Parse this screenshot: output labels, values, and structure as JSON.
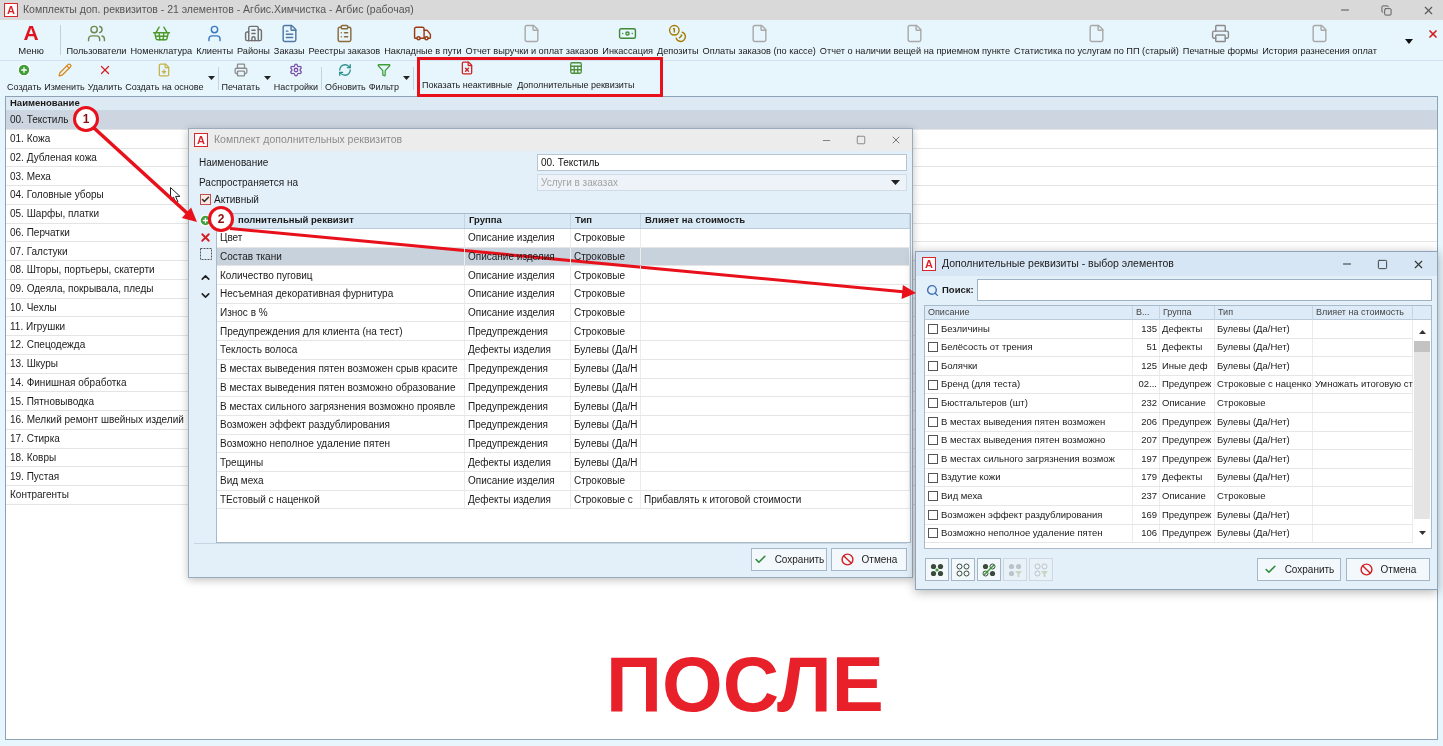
{
  "window": {
    "logo": "A",
    "title": "Комплекты доп. реквизитов - 21 элементов - Агбис.Химчистка - Агбис (рабочая)"
  },
  "ribbon": {
    "menu": {
      "logo": "A",
      "label": "Меню"
    },
    "items": [
      {
        "label": "Пользователи"
      },
      {
        "label": "Номенклатура"
      },
      {
        "label": "Клиенты"
      },
      {
        "label": "Районы"
      },
      {
        "label": "Заказы"
      },
      {
        "label": "Реестры заказов"
      },
      {
        "label": "Накладные в пути"
      },
      {
        "label": "Отчет выручки и оплат заказов"
      },
      {
        "label": "Инкассация"
      },
      {
        "label": "Депозиты"
      },
      {
        "label": "Оплаты заказов (по кассе)"
      },
      {
        "label": "Отчет о наличии вещей на приемном пункте"
      },
      {
        "label": "Статистика по услугам по ПП (старый)"
      },
      {
        "label": "Печатные формы"
      },
      {
        "label": "История разнесения оплат"
      }
    ]
  },
  "toolbar": {
    "groups": [
      {
        "highlighted": false,
        "items": [
          {
            "label": "Создать",
            "dropdown": false
          },
          {
            "label": "Изменить",
            "dropdown": false
          },
          {
            "label": "Удалить",
            "dropdown": false
          },
          {
            "label": "Создать на основе",
            "dropdown": true
          }
        ]
      },
      {
        "highlighted": false,
        "items": [
          {
            "label": "Печатать",
            "dropdown": true
          },
          {
            "label": "Настройки",
            "dropdown": false
          }
        ]
      },
      {
        "highlighted": false,
        "items": [
          {
            "label": "Обновить",
            "dropdown": false
          },
          {
            "label": "Фильтр",
            "dropdown": true
          }
        ]
      },
      {
        "highlighted": true,
        "items": [
          {
            "label": "Показать неактивные",
            "dropdown": false
          },
          {
            "label": "Дополнительные реквизиты",
            "dropdown": false
          }
        ]
      }
    ]
  },
  "list": {
    "column": "Наименование",
    "rows": [
      {
        "label": "00. Текстиль",
        "selected": true
      },
      {
        "label": "01. Кожа",
        "selected": false
      },
      {
        "label": "02. Дубленая кожа",
        "selected": false
      },
      {
        "label": "03. Меха",
        "selected": false
      },
      {
        "label": "04. Головные уборы",
        "selected": false
      },
      {
        "label": "05. Шарфы, платки",
        "selected": false
      },
      {
        "label": "06. Перчатки",
        "selected": false
      },
      {
        "label": "07. Галстуки",
        "selected": false
      },
      {
        "label": "08. Шторы, портьеры, скатерти",
        "selected": false
      },
      {
        "label": "09. Одеяла, покрывала, пледы",
        "selected": false
      },
      {
        "label": "10. Чехлы",
        "selected": false
      },
      {
        "label": "11. Игрушки",
        "selected": false
      },
      {
        "label": "12. Спецодежда",
        "selected": false
      },
      {
        "label": "13. Шкуры",
        "selected": false
      },
      {
        "label": "14. Финишная обработка",
        "selected": false
      },
      {
        "label": "15. Пятновыводка",
        "selected": false
      },
      {
        "label": "16. Мелкий ремонт швейных изделий",
        "selected": false
      },
      {
        "label": "17. Стирка",
        "selected": false
      },
      {
        "label": "18. Ковры",
        "selected": false
      },
      {
        "label": "19. Пустая",
        "selected": false
      },
      {
        "label": "Контрагенты",
        "selected": false
      }
    ]
  },
  "set_dialog": {
    "logo": "A",
    "title": "Комплект дополнительных реквизитов",
    "fields": [
      {
        "label": "Наименование",
        "value": "00. Текстиль",
        "kind": "text",
        "disabled": false
      },
      {
        "label": "Распространяется на",
        "value": "Услуги в заказах",
        "kind": "select",
        "disabled": true
      }
    ],
    "active": {
      "label": "Активный",
      "checked": true
    },
    "table": {
      "columns": [
        "полнительный реквизит",
        "Группа",
        "Тип",
        "Влияет на стоимость"
      ],
      "rows": [
        {
          "selected": false,
          "cells": [
            "Цвет",
            "Описание изделия",
            "Строковые"
          ]
        },
        {
          "selected": true,
          "cells": [
            "Состав ткани",
            "Описание изделия",
            "Строковые"
          ]
        },
        {
          "selected": false,
          "cells": [
            "Количество пуговиц",
            "Описание изделия",
            "Строковые"
          ]
        },
        {
          "selected": false,
          "cells": [
            "Несъемная декоративная фурнитура",
            "Описание изделия",
            "Строковые"
          ]
        },
        {
          "selected": false,
          "cells": [
            "Износ в %",
            "Описание изделия",
            "Строковые"
          ]
        },
        {
          "selected": false,
          "cells": [
            "Предупреждения для клиента (на тест)",
            "Предупреждения",
            "Строковые"
          ]
        },
        {
          "selected": false,
          "cells": [
            "Теклость волоса",
            "Дефекты изделия",
            "Булевы (Да/Н"
          ]
        },
        {
          "selected": false,
          "cells": [
            "В местах выведения пятен возможен срыв красите",
            "Предупреждения",
            "Булевы (Да/Н"
          ]
        },
        {
          "selected": false,
          "cells": [
            "В местах выведения пятен возможно образование",
            "Предупреждения",
            "Булевы (Да/Н"
          ]
        },
        {
          "selected": false,
          "cells": [
            "В местах сильного загрязнения возможно проявле",
            "Предупреждения",
            "Булевы (Да/Н"
          ]
        },
        {
          "selected": false,
          "cells": [
            "Возможен эффект раздублирования",
            "Предупреждения",
            "Булевы (Да/Н"
          ]
        },
        {
          "selected": false,
          "cells": [
            "Возможно неполное удаление пятен",
            "Предупреждения",
            "Булевы (Да/Н"
          ]
        },
        {
          "selected": false,
          "cells": [
            "Трещины",
            "Дефекты изделия",
            "Булевы (Да/Н"
          ]
        },
        {
          "selected": false,
          "cells": [
            "Вид меха",
            "Описание изделия",
            "Строковые"
          ]
        },
        {
          "selected": false,
          "cells": [
            "ТЕстовый с наценкой",
            "Дефекты изделия",
            "Строковые с",
            "Прибавлять к итоговой стоимости"
          ]
        }
      ]
    },
    "buttons": [
      {
        "label": "Сохранить",
        "kind": "save"
      },
      {
        "label": "Отмена",
        "kind": "cancel"
      }
    ]
  },
  "picker_dialog": {
    "logo": "A",
    "title": "Дополнительные реквизиты - выбор элементов",
    "search": {
      "label": "Поиск:"
    },
    "table": {
      "columns": [
        "Описание",
        "В...",
        "Группа",
        "Тип",
        "Влияет на стоимость"
      ],
      "rows": [
        {
          "checked": false,
          "cells": [
            "Безличины",
            "135",
            "Дефекты",
            "Булевы (Да/Нет)"
          ]
        },
        {
          "checked": false,
          "cells": [
            "Белёсость от трения",
            "51",
            "Дефекты",
            "Булевы (Да/Нет)"
          ]
        },
        {
          "checked": false,
          "cells": [
            "Болячки",
            "125",
            "Иные деф",
            "Булевы (Да/Нет)"
          ]
        },
        {
          "checked": false,
          "cells": [
            "Бренд (для теста)",
            "02...",
            "Предупреж",
            "Строковые с наценко",
            "Умножать итоговую ст"
          ]
        },
        {
          "checked": false,
          "cells": [
            "Бюстгальтеров (шт)",
            "232",
            "Описание",
            "Строковые"
          ]
        },
        {
          "checked": false,
          "cells": [
            "В местах выведения пятен возможен",
            "206",
            "Предупреж",
            "Булевы (Да/Нет)"
          ]
        },
        {
          "checked": false,
          "cells": [
            "В местах выведения пятен возможно",
            "207",
            "Предупреж",
            "Булевы (Да/Нет)"
          ]
        },
        {
          "checked": false,
          "cells": [
            "В местах сильного загрязнения возмож",
            "197",
            "Предупреж",
            "Булевы (Да/Нет)"
          ]
        },
        {
          "checked": false,
          "cells": [
            "Вздутие кожи",
            "179",
            "Дефекты",
            "Булевы (Да/Нет)"
          ]
        },
        {
          "checked": false,
          "cells": [
            "Вид меха",
            "237",
            "Описание",
            "Строковые"
          ]
        },
        {
          "checked": false,
          "cells": [
            "Возможен эффект раздублирования",
            "169",
            "Предупреж",
            "Булевы (Да/Нет)"
          ]
        },
        {
          "checked": false,
          "cells": [
            "Возможно неполное удаление пятен",
            "106",
            "Предупреж",
            "Булевы (Да/Нет)"
          ]
        }
      ]
    },
    "tool_buttons": [
      {
        "disabled": false
      },
      {
        "disabled": false
      },
      {
        "disabled": false
      },
      {
        "disabled": true
      },
      {
        "disabled": true
      }
    ],
    "buttons": [
      {
        "label": "Сохранить",
        "kind": "save"
      },
      {
        "label": "Отмена",
        "kind": "cancel"
      }
    ]
  },
  "annotations": {
    "markers": [
      "1",
      "2"
    ],
    "caption": "ПОСЛЕ"
  }
}
